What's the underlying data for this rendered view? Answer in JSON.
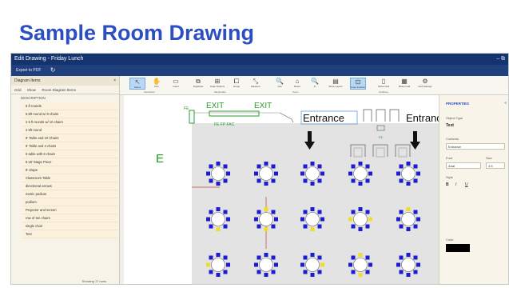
{
  "slide_title": "Sample Room Drawing",
  "window": {
    "title": "Edit Drawing - Friday Lunch",
    "controls": "–  ⧉",
    "export_label": "Export to PDF",
    "refresh_glyph": "↻"
  },
  "left_panel": {
    "header": "Diagram Items",
    "close_glyph": "×",
    "tabs": [
      "Grid",
      "Show",
      "Room Diagram Items"
    ],
    "column_header": "DESCRIPTION",
    "items": [
      "5 ft rounds",
      "5.5ft round w/ 8 chairs",
      "2 5 ft rounds w/ 10 chairs",
      "2 5ft round",
      "6' Table and 10 Chairs",
      "6' Table and 4 chairs",
      "6 table with 8 chairs",
      "8 x8' Stage Piece",
      "8' drape",
      "Classroom Table",
      "directional arrows",
      "metric podium",
      "podium",
      "Projector and screen",
      "row of ten chairs",
      "single chair",
      "Text"
    ],
    "footer": "Showing 17 rows"
  },
  "ribbon": {
    "buttons": [
      {
        "icon": "↖",
        "label": "Select"
      },
      {
        "icon": "✋",
        "label": "Pan"
      },
      {
        "icon": "▭",
        "label": "Insert"
      },
      {
        "icon": "⧉",
        "label": "Duplicate"
      },
      {
        "icon": "⊞",
        "label": "Snap Options"
      },
      {
        "icon": "⧠",
        "label": "Group"
      },
      {
        "icon": "⤡",
        "label": "Measure"
      },
      {
        "icon": "🔍",
        "label": "Out"
      },
      {
        "icon": "⌂",
        "label": "Reset"
      },
      {
        "icon": "🔍",
        "label": "In"
      },
      {
        "icon": "▤",
        "label": "Show Layers"
      },
      {
        "icon": "⊡",
        "label": "Snap Enabled"
      },
      {
        "icon": "▯",
        "label": "Show Grid"
      },
      {
        "icon": "▦",
        "label": "Reset Grid"
      },
      {
        "icon": "⚙",
        "label": "Grid Settings"
      }
    ],
    "groups": [
      "Interaction",
      "Manipulate",
      "Zoom",
      "Gridlines"
    ]
  },
  "canvas": {
    "labels": {
      "exit_1": "EXIT",
      "exit_2": "EXIT",
      "entrance_1": "Entrance",
      "entrance_2": "Entranc",
      "letter_e": "E",
      "fe": "FE",
      "fe_fp_fac": "FE  FP   FAC",
      "fe_small": "FE"
    },
    "colors": {
      "floor": "#e3e3e3",
      "chair_blue": "#1c1cd0",
      "chair_yellow": "#f0dc2a",
      "exit_green": "#2e9a2e",
      "label_green": "#1f9a1f",
      "selection_blue": "#6a9ad8",
      "pipe_red": "#c94040"
    }
  },
  "right_panel": {
    "title": "PROPERTIES",
    "close_glyph": "«",
    "object_type_label": "Object Type",
    "object_type_value": "Text",
    "contents_label": "Contents",
    "contents_value": "Entrance",
    "font_label": "Font",
    "size_label": "Size",
    "font_value": "Arial",
    "size_value": "4.5",
    "style_label": "Style",
    "style_buttons": [
      "B",
      "I",
      "U"
    ],
    "color_label": "Color",
    "color_value": "#000000"
  }
}
